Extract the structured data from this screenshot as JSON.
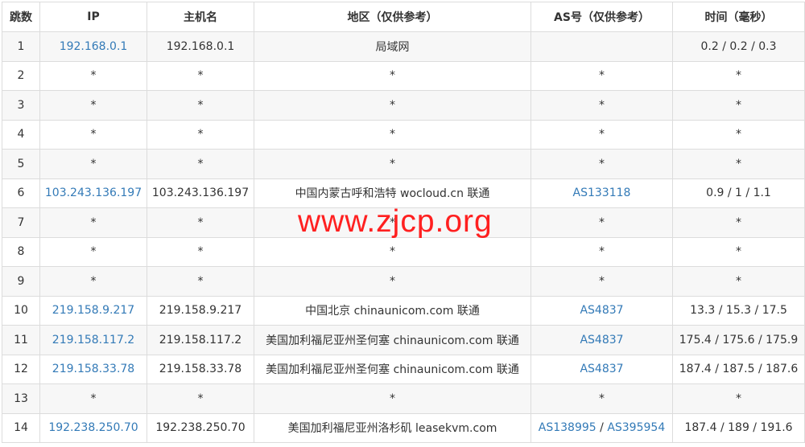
{
  "headers": [
    "跳数",
    "IP",
    "主机名",
    "地区（仅供参考）",
    "AS号（仅供参考）",
    "时间（毫秒）"
  ],
  "rows": [
    {
      "hop": "1",
      "ip": "192.168.0.1",
      "host": "192.168.0.1",
      "region": "局域网",
      "as": [],
      "time": "0.2 / 0.2 / 0.3"
    },
    {
      "hop": "2",
      "ip": "*",
      "host": "*",
      "region": "*",
      "as": [
        "*"
      ],
      "time": "*"
    },
    {
      "hop": "3",
      "ip": "*",
      "host": "*",
      "region": "*",
      "as": [
        "*"
      ],
      "time": "*"
    },
    {
      "hop": "4",
      "ip": "*",
      "host": "*",
      "region": "*",
      "as": [
        "*"
      ],
      "time": "*"
    },
    {
      "hop": "5",
      "ip": "*",
      "host": "*",
      "region": "*",
      "as": [
        "*"
      ],
      "time": "*"
    },
    {
      "hop": "6",
      "ip": "103.243.136.197",
      "host": "103.243.136.197",
      "region": "中国内蒙古呼和浩特 wocloud.cn 联通",
      "as": [
        "AS133118"
      ],
      "time": "0.9 / 1 / 1.1"
    },
    {
      "hop": "7",
      "ip": "*",
      "host": "*",
      "region": "*",
      "as": [
        "*"
      ],
      "time": "*"
    },
    {
      "hop": "8",
      "ip": "*",
      "host": "*",
      "region": "*",
      "as": [
        "*"
      ],
      "time": "*"
    },
    {
      "hop": "9",
      "ip": "*",
      "host": "*",
      "region": "*",
      "as": [
        "*"
      ],
      "time": "*"
    },
    {
      "hop": "10",
      "ip": "219.158.9.217",
      "host": "219.158.9.217",
      "region": "中国北京 chinaunicom.com 联通",
      "as": [
        "AS4837"
      ],
      "time": "13.3 / 15.3 / 17.5"
    },
    {
      "hop": "11",
      "ip": "219.158.117.2",
      "host": "219.158.117.2",
      "region": "美国加利福尼亚州圣何塞 chinaunicom.com 联通",
      "as": [
        "AS4837"
      ],
      "time": "175.4 / 175.6 / 175.9"
    },
    {
      "hop": "12",
      "ip": "219.158.33.78",
      "host": "219.158.33.78",
      "region": "美国加利福尼亚州圣何塞 chinaunicom.com 联通",
      "as": [
        "AS4837"
      ],
      "time": "187.4 / 187.5 / 187.6"
    },
    {
      "hop": "13",
      "ip": "*",
      "host": "*",
      "region": "*",
      "as": [
        "*"
      ],
      "time": "*"
    },
    {
      "hop": "14",
      "ip": "192.238.250.70",
      "host": "192.238.250.70",
      "region": "美国加利福尼亚州洛杉矶 leasekvm.com",
      "as": [
        "AS138995",
        "AS395954"
      ],
      "time": "187.4 / 189 / 191.6"
    }
  ],
  "as_separator": " / ",
  "watermark": "www.zjcp.org",
  "colors": {
    "link": "#337ab7",
    "watermark": "#ff2020",
    "stripe": "#f7f7f7",
    "border": "#dcdcdc"
  }
}
